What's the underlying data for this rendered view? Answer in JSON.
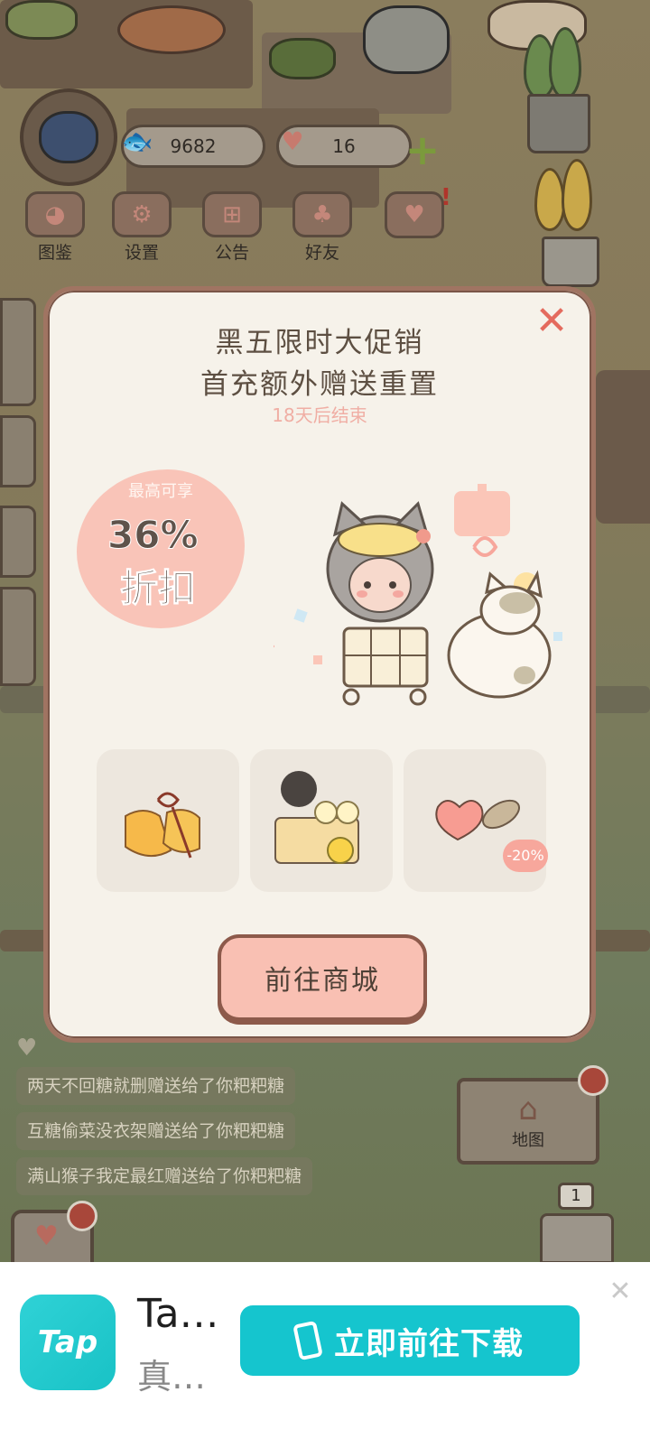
{
  "hud": {
    "currency_fish": "9682",
    "currency_hearts": "16"
  },
  "menu": [
    {
      "label": "图鉴"
    },
    {
      "label": "设置"
    },
    {
      "label": "公告"
    },
    {
      "label": "好友"
    }
  ],
  "popup": {
    "title_line1": "黑五限时大促销",
    "title_line2": "首充额外赠送重置",
    "countdown": "18天后结束",
    "badge_top": "最高可享",
    "badge_percent": "36%",
    "badge_word": "折扣",
    "items": [
      {
        "icon": "bell-icon"
      },
      {
        "icon": "drink-stand-icon"
      },
      {
        "icon": "heart-fish-icon",
        "discount": "-20%"
      }
    ],
    "shop_button": "前往商城"
  },
  "chat": [
    "两天不回糖就删赠送给了你粑粑糖",
    "互糖偷菜没衣架赠送给了你粑粑糖",
    "满山猴子我定最红赠送给了你粑粑糖"
  ],
  "map_button": "地图",
  "counter_badge": "1",
  "ad": {
    "app_title": "Ta…",
    "app_subtitle": "真…",
    "logo_text": "Tap",
    "cta": "立即前往下载"
  }
}
